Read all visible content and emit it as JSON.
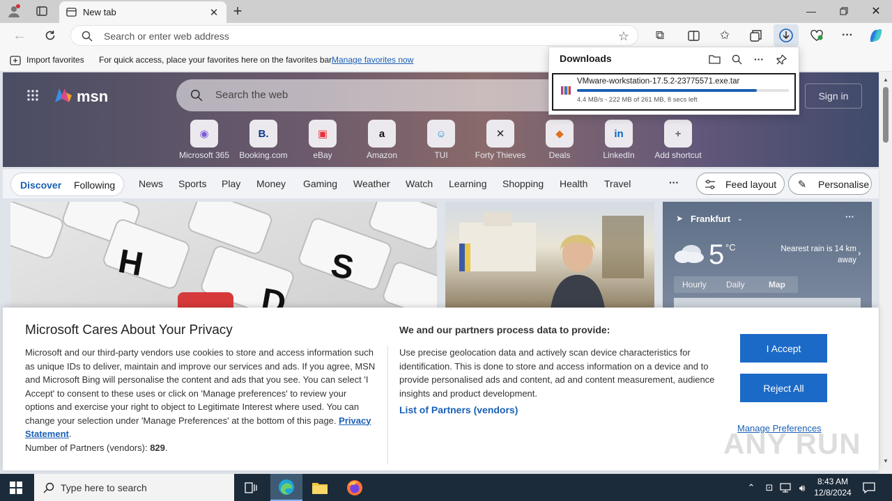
{
  "browser": {
    "tab_title": "New tab",
    "address_placeholder": "Search or enter web address"
  },
  "favorites_bar": {
    "import_label": "Import favorites",
    "hint_text": "For quick access, place your favorites here on the favorites bar.",
    "manage_link": "Manage favorites now"
  },
  "downloads": {
    "title": "Downloads",
    "file_name": "VMware-workstation-17.5.2-23775571.exe.tar",
    "status": "4.4 MB/s - 222 MB of 261 MB, 8 secs left",
    "progress_fraction": 0.85
  },
  "msn": {
    "logo_text": "msn",
    "search_placeholder": "Search the web",
    "sign_in": "Sign in",
    "shortcuts": [
      {
        "label": "Microsoft 365",
        "glyph": "◉",
        "color": "#7b5cd6"
      },
      {
        "label": "Booking.com",
        "glyph": "B.",
        "color": "#0b3b8a"
      },
      {
        "label": "eBay",
        "glyph": "▣",
        "color": "#e53238"
      },
      {
        "label": "Amazon",
        "glyph": "a",
        "color": "#111111"
      },
      {
        "label": "TUI",
        "glyph": "☺",
        "color": "#1e8ed8"
      },
      {
        "label": "Forty Thieves",
        "glyph": "✕",
        "color": "#222222"
      },
      {
        "label": "Deals",
        "glyph": "◆",
        "color": "#e0701c"
      },
      {
        "label": "LinkedIn",
        "glyph": "in",
        "color": "#0a66c2"
      },
      {
        "label": "Add shortcut",
        "glyph": "+",
        "color": "#666666"
      }
    ],
    "nav": {
      "discover": "Discover",
      "following": "Following",
      "items": [
        "News",
        "Sports",
        "Play",
        "Money",
        "Gaming",
        "Weather",
        "Watch",
        "Learning",
        "Shopping",
        "Health",
        "Travel"
      ],
      "more": "···",
      "feed_layout": "Feed layout",
      "personalise": "Personalise"
    },
    "weather": {
      "location": "Frankfurt",
      "temperature": "5",
      "unit": "°C",
      "rain_text": "Nearest rain is 14 km away",
      "tabs": [
        "Hourly",
        "Daily",
        "Map"
      ]
    }
  },
  "privacy": {
    "title": "Microsoft Cares About Your Privacy",
    "body": "Microsoft and our third-party vendors use cookies to store and access information such as unique IDs to deliver, maintain and improve our services and ads. If you agree, MSN and Microsoft Bing will personalise the content and ads that you see. You can select 'I Accept' to consent to these uses or click on 'Manage preferences' to review your options and exercise your right to object to Legitimate Interest where used.  You can change your selection under 'Manage Preferences' at the bottom of this page.",
    "privacy_link": "Privacy Statement",
    "partners_label": "Number of Partners (vendors):",
    "partners_count": "829",
    "right_title": "We and our partners process data to provide:",
    "right_body": "Use precise geolocation data and actively scan device characteristics for identification. This is done to store and access information on a device and to provide personalised ads and content, ad and content measurement, audience insights and product development.",
    "vendors_link": "List of Partners (vendors)",
    "accept": "I Accept",
    "reject": "Reject All",
    "manage": "Manage Preferences"
  },
  "taskbar": {
    "search_placeholder": "Type here to search",
    "time": "8:43 AM",
    "date": "12/8/2024"
  },
  "watermark": "ANY RUN"
}
